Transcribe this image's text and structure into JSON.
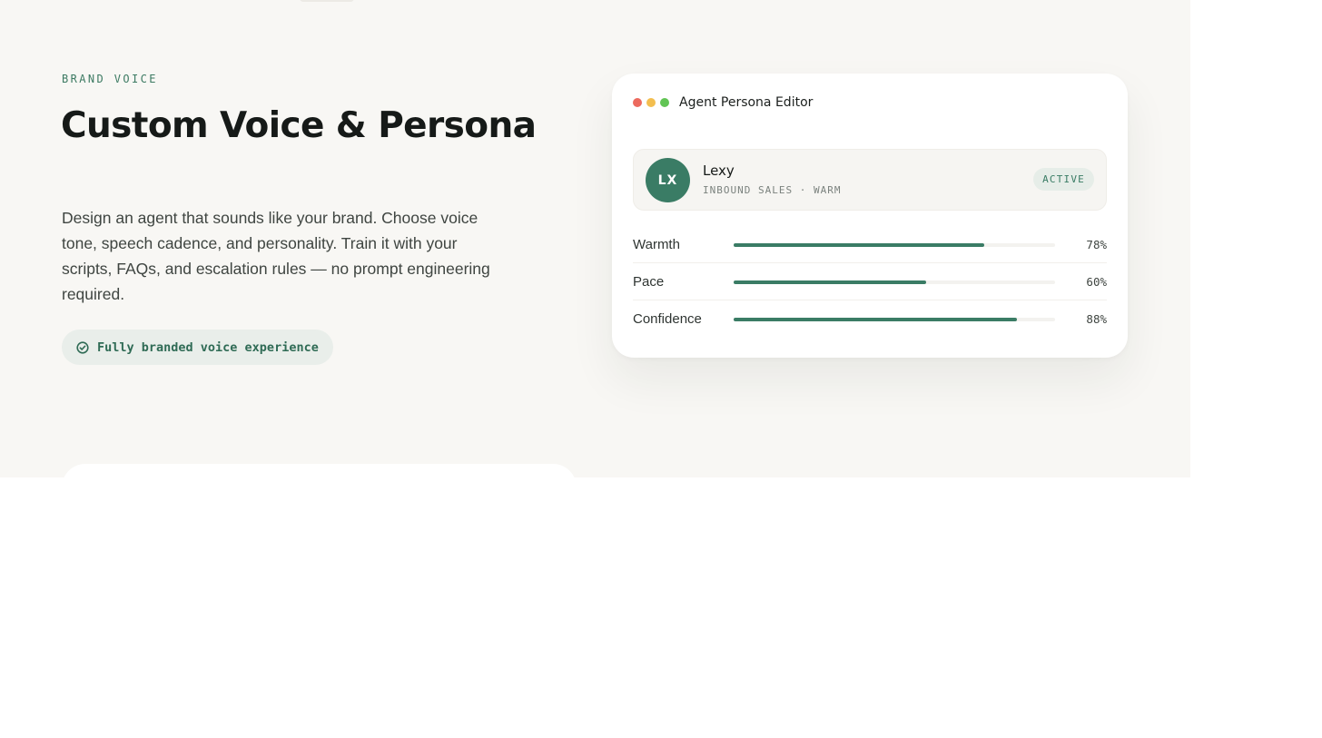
{
  "section": {
    "eyebrow": "BRAND VOICE",
    "headline": "Custom Voice & Persona",
    "description": "Design an agent that sounds like your brand. Choose voice tone, speech cadence, and personality. Train it with your scripts, FAQs, and escalation rules — no prompt engineering required.",
    "highlight": {
      "icon": "check-circle-icon",
      "text": "Fully branded voice experience"
    }
  },
  "editor": {
    "window_controls": [
      "close-dot",
      "minimize-dot",
      "maximize-dot"
    ],
    "title": "Agent Persona Editor",
    "persona": {
      "initials": "LX",
      "name": "Lexy",
      "meta": "INBOUND SALES · WARM",
      "status": "ACTIVE"
    },
    "sliders": [
      {
        "label": "Warmth",
        "value_text": "78%",
        "value": 78
      },
      {
        "label": "Pace",
        "value_text": "60%",
        "value": 60
      },
      {
        "label": "Confidence",
        "value_text": "88%",
        "value": 88
      }
    ]
  },
  "colors": {
    "accent": "#3a7c65",
    "background": "#f8f7f4",
    "heading": "#161a18",
    "dot_red": "#ec6a5e",
    "dot_yellow": "#f3be4f",
    "dot_green": "#61c454"
  }
}
